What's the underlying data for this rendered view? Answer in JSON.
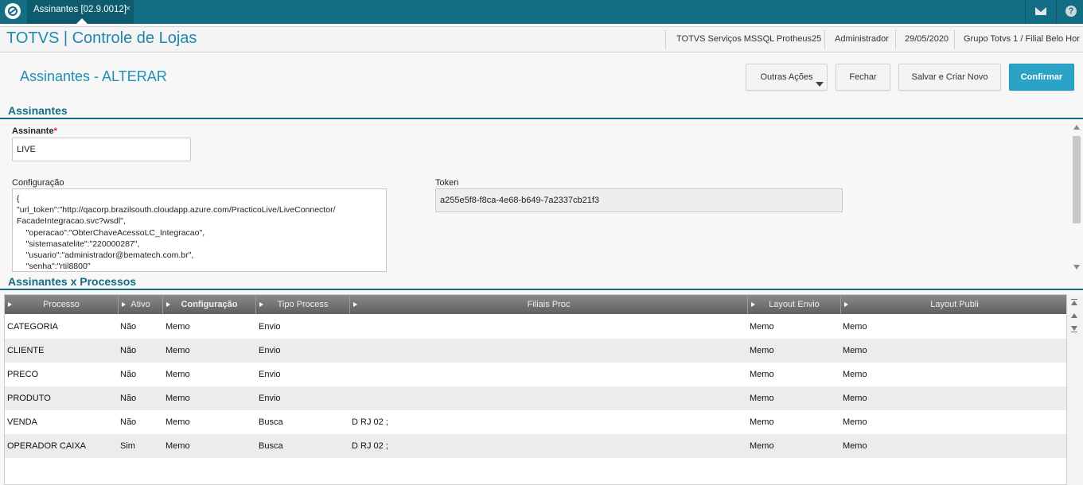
{
  "topbar": {
    "tab_label": "Assinantes [02.9.0012]",
    "tab_close": "×"
  },
  "header": {
    "app_title": "TOTVS | Controle de Lojas",
    "environment": "TOTVS Serviços MSSQL Protheus25",
    "user": "Administrador",
    "date": "29/05/2020",
    "branch": "Grupo Totvs 1 / Filial Belo Hor"
  },
  "page": {
    "title": "Assinantes - ALTERAR"
  },
  "actions": {
    "more": "Outras Ações",
    "close": "Fechar",
    "save_new": "Salvar e Criar Novo",
    "confirm": "Confirmar"
  },
  "form": {
    "section_title": "Assinantes",
    "assinante_label": "Assinante",
    "assinante_required": "*",
    "assinante_value": "LIVE",
    "config_label": "Configuração",
    "config_lines": [
      "{",
      "\"url_token\":\"http://qacorp.brazilsouth.cloudapp.azure.com/PracticoLive/LiveConnector/",
      "FacadeIntegracao.svc?wsdl\",",
      "    \"operacao\":\"ObterChaveAcessoLC_Integracao\",",
      "    \"sistemasatelite\":\"220000287\",",
      "    \"usuario\":\"administrador@bematech.com.br\",",
      "    \"senha\":\"rtil8800\""
    ],
    "token_label": "Token",
    "token_value": "a255e5f8-f8ca-4e68-b649-7a2337cb21f3"
  },
  "grid": {
    "section_title": "Assinantes x Processos",
    "columns": [
      "Processo",
      "Ativo",
      "Configuração",
      "Tipo Process",
      "Filiais Proc",
      "Layout Envio",
      "Layout Publi"
    ],
    "rows": [
      [
        "CATEGORIA",
        "Não",
        "Memo",
        "Envio",
        "",
        "Memo",
        "Memo"
      ],
      [
        "CLIENTE",
        "Não",
        "Memo",
        "Envio",
        "",
        "Memo",
        "Memo"
      ],
      [
        "PRECO",
        "Não",
        "Memo",
        "Envio",
        "",
        "Memo",
        "Memo"
      ],
      [
        "PRODUTO",
        "Não",
        "Memo",
        "Envio",
        "",
        "Memo",
        "Memo"
      ],
      [
        "VENDA",
        "Não",
        "Memo",
        "Busca",
        "D RJ 02 ;",
        "Memo",
        "Memo"
      ],
      [
        "OPERADOR CAIXA",
        "Sim",
        "Memo",
        "Busca",
        "D RJ 02 ;",
        "Memo",
        "Memo"
      ]
    ]
  },
  "colors": {
    "brand": "#136d85",
    "accent": "#2aa3c6",
    "title_blue": "#1d87b0"
  }
}
